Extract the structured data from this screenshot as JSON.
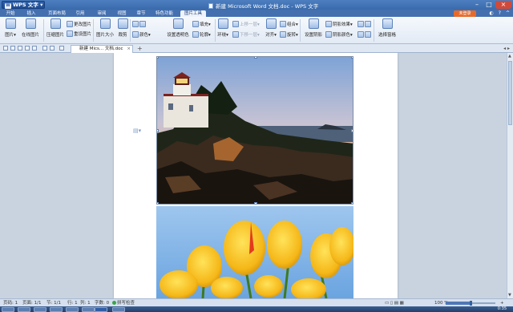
{
  "app": {
    "button_label": "WPS 文字",
    "window_title": "新建 Microsoft Word 文档.doc - WPS 文字",
    "login_label": "未登录"
  },
  "menu": {
    "tabs": [
      "开始",
      "插入",
      "页面布局",
      "引用",
      "审阅",
      "视图",
      "章节",
      "特色功能",
      "图片工具"
    ],
    "active_tab": "图片工具"
  },
  "ribbon": {
    "insert_picture": "图片",
    "online_picture": "在线图片",
    "compress_picture": "压缩图片",
    "change_picture": "更改图片",
    "reset_picture": "重设图片",
    "picture_size": "图片大小",
    "crop": "裁剪",
    "color": "颜色",
    "set_transparent": "设置透明色",
    "outline": "轮廓",
    "fill": "填充",
    "wrap": "环绕",
    "bring_forward": "上移一层",
    "send_backward": "下移一层",
    "align": "对齐",
    "group": "组合",
    "rotate": "旋转",
    "set_shadow": "设置阴影",
    "shadow_effect": "阴影效果",
    "shadow_color": "阴影颜色",
    "selection_pane": "选择窗格"
  },
  "document_tab": {
    "title": "新建 Mics... 文档.doc"
  },
  "status": {
    "page": "页码: 1",
    "pages": "页面: 1/1",
    "section": "节: 1/1",
    "row": "行: 1",
    "col": "列: 1",
    "words": "字数: 0",
    "spell": "拼写检查",
    "zoom_label": "100 %",
    "zoom_percent": 100
  },
  "taskbar": {
    "clock": "0:35"
  },
  "colors": {
    "title_bar": "#3a6aab",
    "login_button": "#e76a2a",
    "active_tab_text": "#1d3f77"
  }
}
